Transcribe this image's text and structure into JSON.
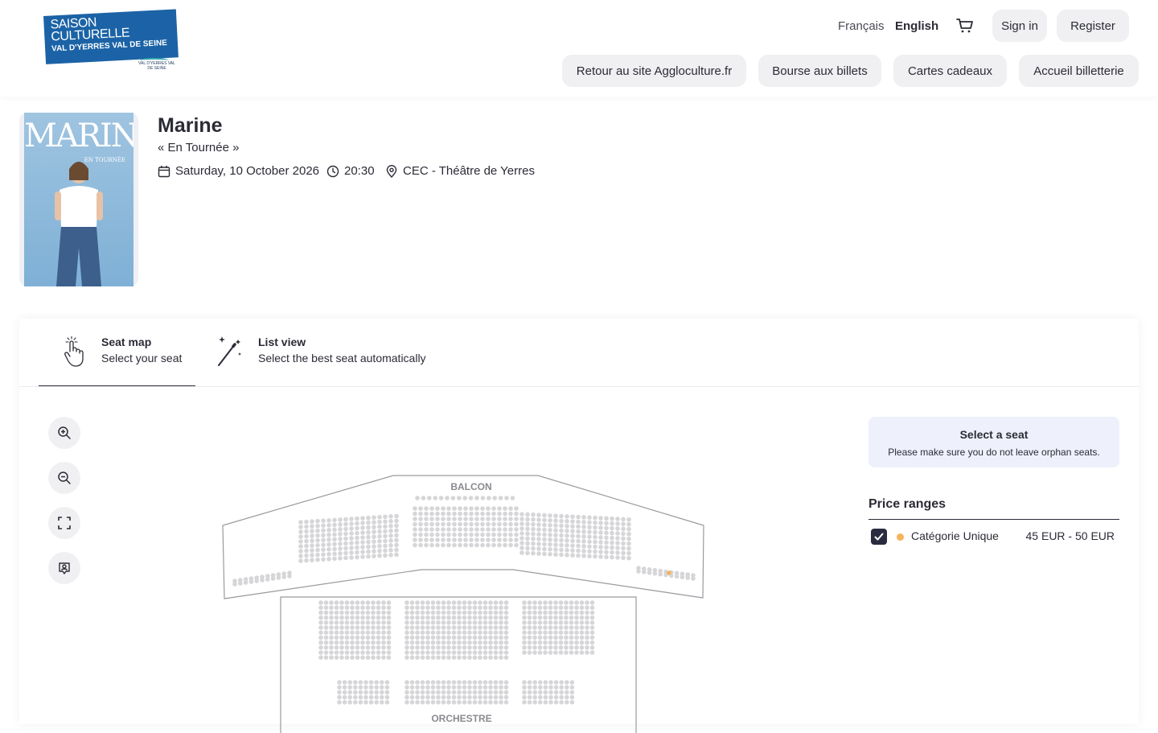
{
  "header": {
    "logo": {
      "line1": "SAISON",
      "line2": "CULTURELLE",
      "line3": "VAL D'YERRES VAL DE SEINE",
      "sub": "VAL D'YERRES VAL DE SEINE"
    },
    "lang_fr": "Français",
    "lang_en": "English",
    "cart_icon": "cart-icon",
    "sign_in": "Sign in",
    "register": "Register",
    "nav": [
      "Retour au site Aggloculture.fr",
      "Bourse aux billets",
      "Cartes cadeaux",
      "Accueil billetterie"
    ]
  },
  "event": {
    "poster_title": "MARINE",
    "poster_sub": "EN TOURNÉE",
    "title": "Marine",
    "subtitle": "« En Tournée »",
    "date": "Saturday, 10 October 2026",
    "time": "20:30",
    "venue": "CEC - Théâtre de Yerres"
  },
  "tabs": [
    {
      "title": "Seat map",
      "desc": "Select your seat",
      "icon": "hand-pointer-icon"
    },
    {
      "title": "List view",
      "desc": "Select the best seat automatically",
      "icon": "magic-wand-icon"
    }
  ],
  "seatmap": {
    "balcony_label": "BALCON",
    "orchestra_label": "ORCHESTRE"
  },
  "sidebar": {
    "info_title": "Select a seat",
    "info_desc": "Please make sure you do not leave orphan seats.",
    "price_title": "Price ranges",
    "category": {
      "label": "Catégorie Unique",
      "price": "45 EUR - 50 EUR",
      "color": "#f5b35a"
    }
  },
  "colors": {
    "accent": "#2b2b3f",
    "brand": "#1b63a6",
    "seat": "#d6d6d9",
    "pill_bg": "#f0f0f3"
  }
}
